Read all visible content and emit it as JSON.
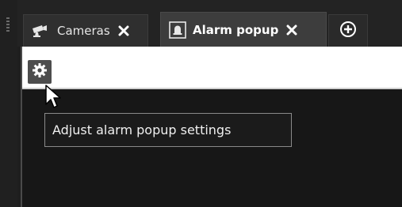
{
  "tabs": [
    {
      "label": "Cameras",
      "icon": "camera-icon",
      "active": false
    },
    {
      "label": "Alarm popup",
      "icon": "alarm-bell-icon",
      "active": true
    }
  ],
  "add_tab_icon": "plus-circle-icon",
  "toolbar": {
    "settings_icon": "gear-icon"
  },
  "tooltip": {
    "text": "Adjust alarm popup settings"
  },
  "colors": {
    "background": "#1e1e1e",
    "tab_inactive": "#2f2f2f",
    "tab_active": "#3d3d3d",
    "toolbar": "#ffffff",
    "gear_button": "#4d4d4d"
  }
}
